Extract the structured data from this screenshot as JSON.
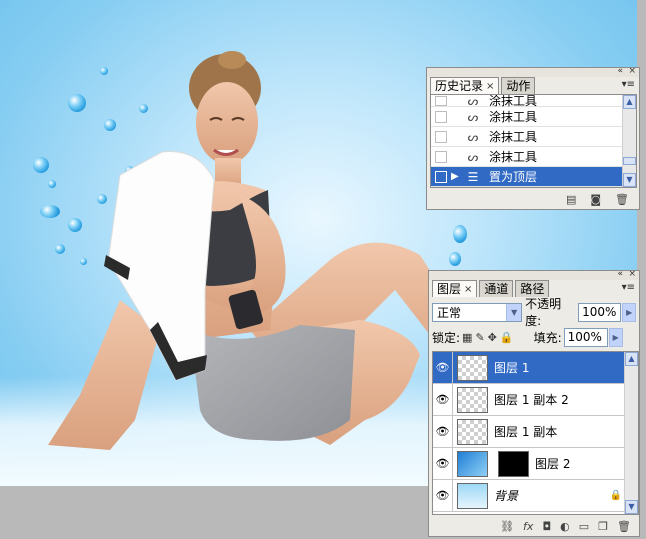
{
  "history_panel": {
    "tabs": [
      {
        "label": "历史记录",
        "active": true
      },
      {
        "label": "动作",
        "active": false
      }
    ],
    "items": [
      {
        "label": "涂抹工具",
        "icon": "smudge-tool-icon"
      },
      {
        "label": "涂抹工具",
        "icon": "smudge-tool-icon"
      },
      {
        "label": "涂抹工具",
        "icon": "smudge-tool-icon"
      },
      {
        "label": "涂抹工具",
        "icon": "smudge-tool-icon"
      },
      {
        "label": "置为顶层",
        "icon": "bring-to-front-icon",
        "selected": true
      }
    ]
  },
  "layers_panel": {
    "tabs": [
      {
        "label": "图层",
        "active": true
      },
      {
        "label": "通道",
        "active": false
      },
      {
        "label": "路径",
        "active": false
      }
    ],
    "blend_mode": "正常",
    "opacity_label": "不透明度:",
    "opacity_value": "100%",
    "lock_label": "锁定:",
    "fill_label": "填充:",
    "fill_value": "100%",
    "layers": [
      {
        "name": "图层 1",
        "selected": true
      },
      {
        "name": "图层 1 副本 2"
      },
      {
        "name": "图层 1 副本"
      },
      {
        "name": "图层 2"
      },
      {
        "name": "背景",
        "locked": true
      }
    ]
  },
  "colors": {
    "selection": "#316ac5",
    "panel_bg": "#ecebe5"
  }
}
